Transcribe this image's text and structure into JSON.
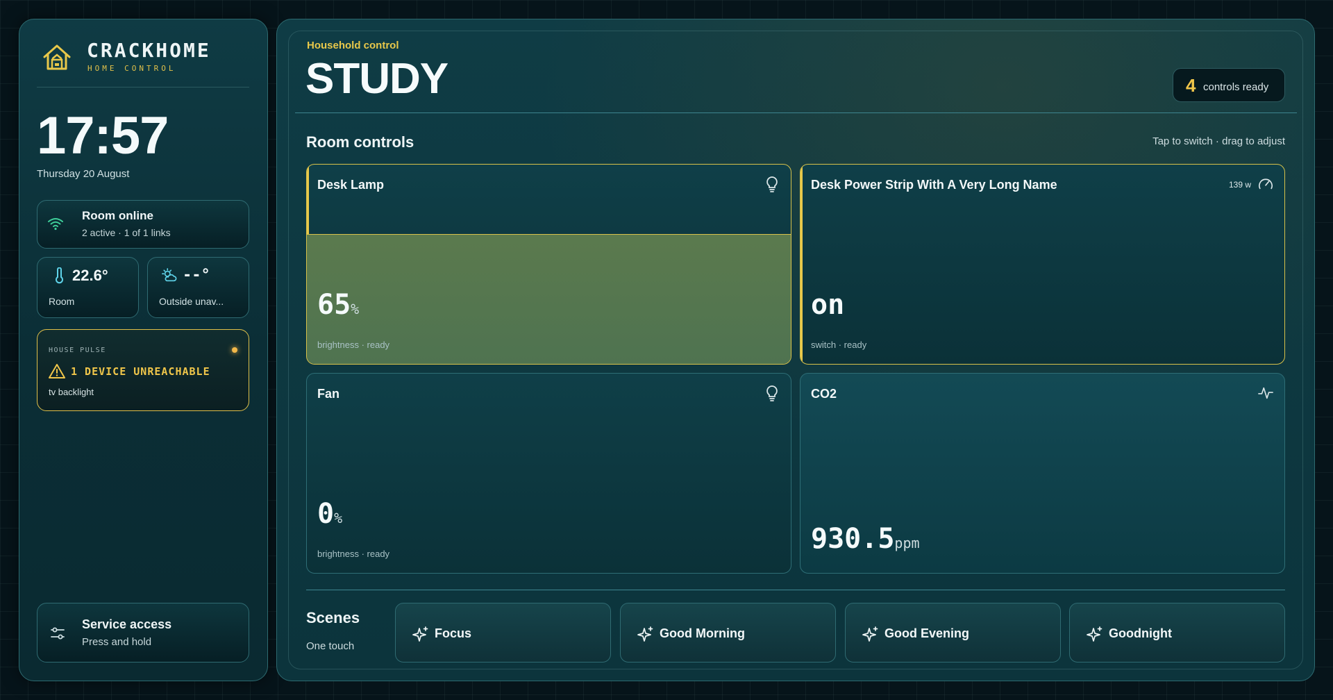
{
  "brand": {
    "title": "CRACKHOME",
    "subtitle": "HOME CONTROL"
  },
  "clock": {
    "time": "17:57",
    "date": "Thursday 20 August"
  },
  "status": {
    "title": "Room online",
    "detail": "2 active · 1 of 1 links",
    "icon": "wifi-icon"
  },
  "climate": {
    "room": {
      "value": "22.6°",
      "label": "Room",
      "icon": "thermometer-icon"
    },
    "outside": {
      "value": "--°",
      "label": "Outside unav...",
      "icon": "partly-cloudy-icon"
    }
  },
  "pulse": {
    "label": "HOUSE PULSE",
    "title": "1 DEVICE UNREACHABLE",
    "detail": "tv backlight",
    "accent": "#f0c64a"
  },
  "service": {
    "title": "Service access",
    "detail": "Press and hold"
  },
  "header": {
    "eyebrow": "Household control",
    "room": "STUDY",
    "ready_count": "4",
    "ready_text": "controls ready"
  },
  "controls": {
    "title": "Room controls",
    "hint": "Tap to switch · drag to adjust",
    "tiles": [
      {
        "name": "Desk Lamp",
        "value": "65",
        "unit": "%",
        "sub": "brightness · ready",
        "icon": "lightbulb-icon",
        "active": true,
        "level": 0.65
      },
      {
        "name": "Desk Power Strip With A Very Long Name",
        "watts": "139 w",
        "value": "on",
        "unit": "",
        "sub": "switch · ready",
        "icon": "gauge-icon",
        "active": true
      },
      {
        "name": "Fan",
        "value": "0",
        "unit": "%",
        "sub": "brightness · ready",
        "icon": "lightbulb-icon",
        "active": false,
        "level": 0
      },
      {
        "name": "CO2",
        "value": "930.5",
        "unit": "ppm",
        "sub": "",
        "icon": "activity-icon",
        "active": false
      }
    ]
  },
  "scenes": {
    "title": "Scenes",
    "subtitle": "One touch",
    "items": [
      {
        "label": "Focus",
        "icon": "sparkles-icon"
      },
      {
        "label": "Good Morning",
        "icon": "sparkles-icon"
      },
      {
        "label": "Good Evening",
        "icon": "sparkles-icon"
      },
      {
        "label": "Goodnight",
        "icon": "sparkles-icon"
      }
    ]
  },
  "colors": {
    "accent": "#e8c84a",
    "panel": "#0f3c45",
    "border": "#2d6a70"
  }
}
